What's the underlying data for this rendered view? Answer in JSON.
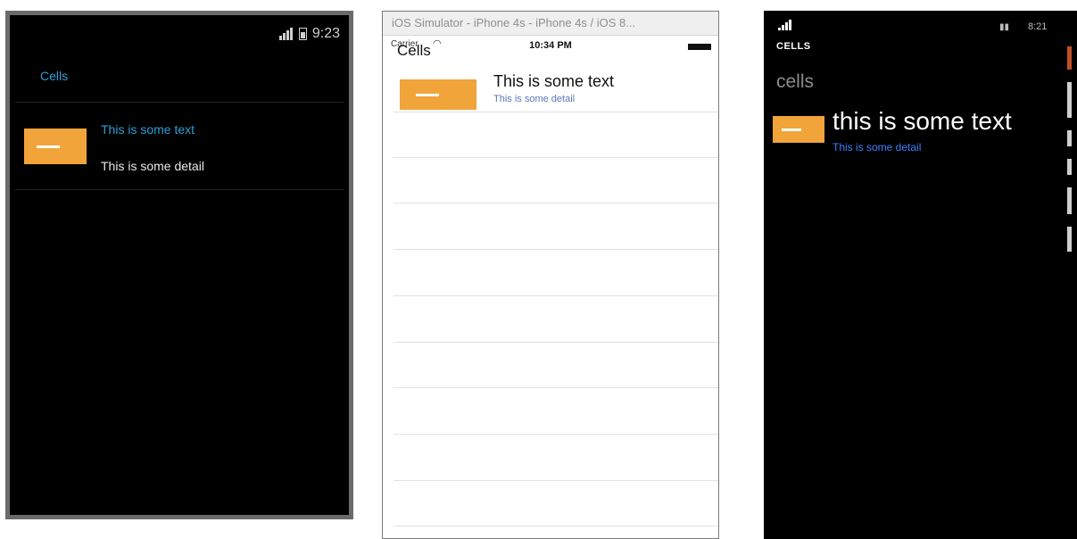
{
  "android": {
    "status_time": "9:23",
    "title": "Cells",
    "cell": {
      "text": "This is some text",
      "detail": "This is some detail"
    }
  },
  "ios": {
    "window_title": "iOS Simulator - iPhone 4s - iPhone 4s / iOS 8...",
    "carrier": "Carrier",
    "status_time": "10:34 PM",
    "nav_title": "Cells",
    "cell": {
      "text": "This is some text",
      "detail": "This is some detail"
    }
  },
  "windows_phone": {
    "status_time": "8:21",
    "app_title": "CELLS",
    "page_title": "cells",
    "cell": {
      "text": "this is some text",
      "detail": "This is some detail"
    }
  },
  "colors": {
    "android_accent": "#2f9fd8",
    "thumbnail": "#f0a43a",
    "ios_detail": "#5a79b8",
    "wp_detail": "#3b82ff"
  }
}
